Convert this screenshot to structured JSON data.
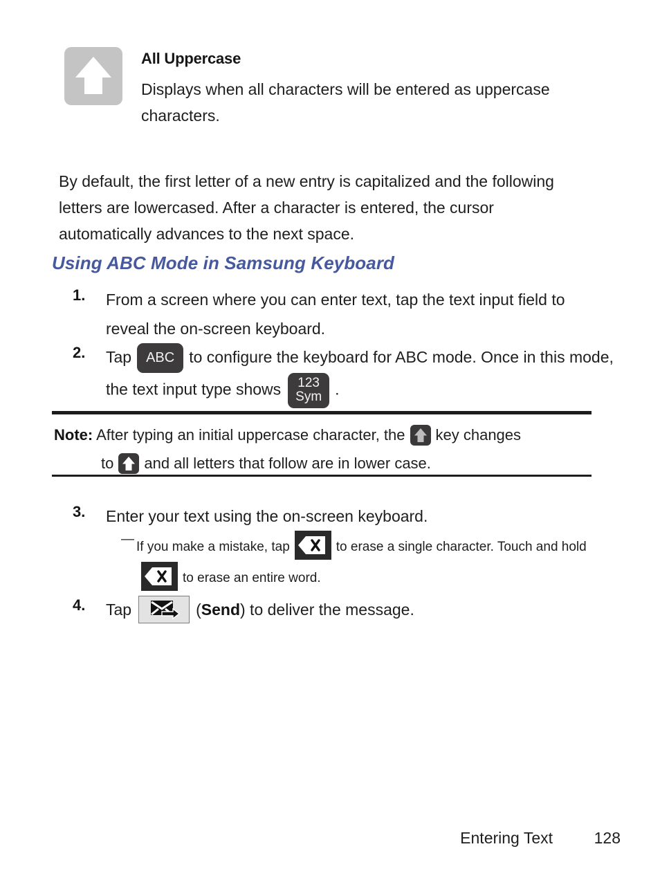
{
  "definition": {
    "icon_name": "all-uppercase-shift-icon",
    "title": "All Uppercase",
    "description": "Displays when all characters will be entered as uppercase characters.",
    "icon_bg_color": "#c4c4c4",
    "icon_arrow_color": "#ffffff"
  },
  "intro": {
    "paragraph": "By default, the first letter of a new entry is capitalized and the following letters are lowercased. After a character is entered, the cursor automatically advances to the next space."
  },
  "heading": {
    "text": "Using ABC Mode in Samsung Keyboard",
    "color": "#47599e"
  },
  "steps": [
    {
      "number": "1.",
      "text_before": "From a screen where you can enter text, tap the text input field to reveal the on-screen keyboard.",
      "text_after": ""
    },
    {
      "number": "2.",
      "text_before": "Tap",
      "key_abc": "ABC",
      "text_middle": "to configure the keyboard for ABC mode. Once in this mode, the text input type shows",
      "key_123": "123",
      "key_sym": "Sym",
      "text_after": "."
    },
    {
      "number": "3.",
      "text_before": "Enter your text using the on-screen keyboard.",
      "text_after": ""
    },
    {
      "number": "4.",
      "text_before": "Tap",
      "text_middle": "(",
      "send_label": "Send",
      "text_after": ") to deliver the message."
    }
  ],
  "note": {
    "label": "Note:",
    "line1_before": "After typing an initial uppercase character, the",
    "line1_after": "key changes",
    "line2_before": "to",
    "line2_after": "and all letters that follow are in lower case."
  },
  "subbullet": {
    "dash": "—",
    "text_before": "If you make a mistake, tap",
    "text_middle": "to erase a single character. Touch and hold",
    "text_after": "to erase an entire word."
  },
  "footer": {
    "section": "Entering Text",
    "page": "128"
  }
}
